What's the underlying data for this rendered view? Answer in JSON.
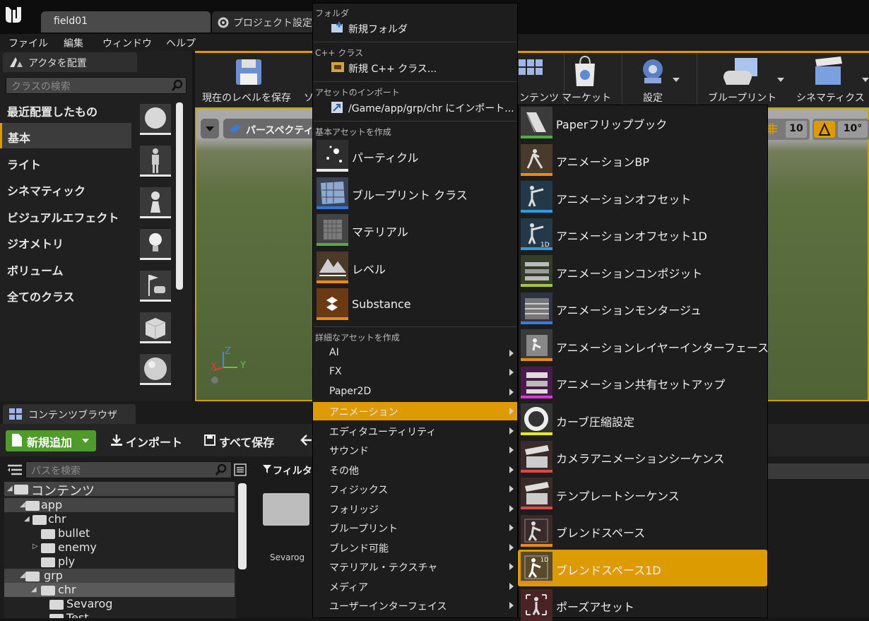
{
  "app": {
    "doc_tabs": [
      "field01",
      "プロジェクト設定"
    ],
    "menu": [
      "ファイル",
      "編集",
      "ウィンドウ",
      "ヘルプ"
    ]
  },
  "place_actors": {
    "tab_label": "アクタを配置",
    "search_placeholder": "クラスの検索",
    "categories": [
      "最近配置したもの",
      "基本",
      "ライト",
      "シネマティック",
      "ビジュアルエフェクト",
      "ジオメトリ",
      "ボリューム",
      "全てのクラス"
    ],
    "selected_category": "基本"
  },
  "toolbar": {
    "items": [
      "現在のレベルを保存",
      "ソ",
      "ンテンツ",
      "マーケット",
      "設定",
      "ブループリント",
      "シネマティクス"
    ]
  },
  "viewport": {
    "perspective_label": "パースペクティ",
    "grid_value": "10",
    "angle_value": "10°",
    "axis_labels": [
      "Z",
      "X",
      "Y"
    ]
  },
  "content_browser": {
    "tab_label": "コンテンツブラウザ",
    "add_new": "新規追加",
    "import": "インポート",
    "save_all": "すべて保存",
    "path_search_placeholder": "パスを検索",
    "filter_label": "フィルタ",
    "asset_name": "Sevarog",
    "tree": [
      {
        "label": "コンテンツ",
        "level": 0
      },
      {
        "label": "app",
        "level": 1
      },
      {
        "label": "chr",
        "level": 2
      },
      {
        "label": "bullet",
        "level": 3
      },
      {
        "label": "enemy",
        "level": 3
      },
      {
        "label": "ply",
        "level": 3
      },
      {
        "label": "grp",
        "level": 1
      },
      {
        "label": "chr",
        "level": 2
      },
      {
        "label": "Sevarog",
        "level": 3
      },
      {
        "label": "Test",
        "level": 3
      }
    ]
  },
  "context_menu": {
    "sections": {
      "folder": "フォルダ",
      "cpp": "C++ クラス",
      "import": "アセットのインポート",
      "basic": "基本アセットを作成",
      "advanced": "詳細なアセットを作成"
    },
    "new_folder": "新規フォルダ",
    "new_cpp": "新規 C++ クラス...",
    "import_to": "/Game/app/grp/chr にインポート...",
    "basic_assets": [
      "パーティクル",
      "ブループリント クラス",
      "マテリアル",
      "レベル",
      "Substance"
    ],
    "advanced_categories": [
      "AI",
      "FX",
      "Paper2D",
      "アニメーション",
      "エディタユーティリティ",
      "サウンド",
      "その他",
      "フィジックス",
      "フォリッジ",
      "ブループリント",
      "ブレンド可能",
      "マテリアル・テクスチャ",
      "メディア",
      "ユーザーインターフェイス"
    ],
    "selected_category": "アニメーション"
  },
  "animation_submenu": {
    "items": [
      "Paperフリップブック",
      "アニメーションBP",
      "アニメーションオフセット",
      "アニメーションオフセット1D",
      "アニメーションコンポジット",
      "アニメーションモンタージュ",
      "アニメーションレイヤーインターフェース",
      "アニメーション共有セットアップ",
      "カーブ圧縮設定",
      "カメラアニメーションシーケンス",
      "テンプレートシーケンス",
      "ブレンドスペース",
      "ブレンドスペース1D",
      "ポーズアセット"
    ],
    "selected": "ブレンドスペース1D"
  },
  "colors": {
    "accent": "#dc9b00",
    "add_button": "#4e9a2b"
  }
}
